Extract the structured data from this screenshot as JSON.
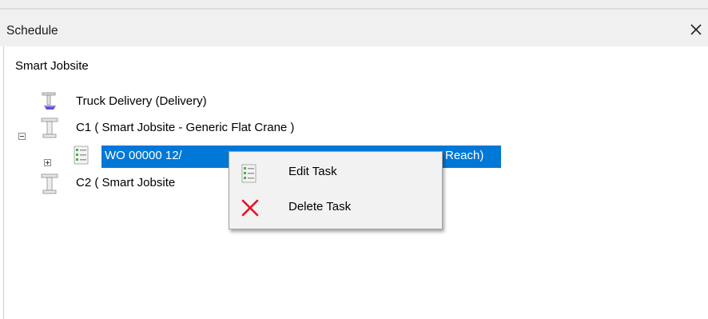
{
  "panel": {
    "title": "Schedule",
    "close_glyph": "✕"
  },
  "tree": {
    "root_label": "Smart Jobsite",
    "truck_label": "Truck Delivery (Delivery)",
    "c1_label": "C1 ( Smart Jobsite - Generic Flat Crane )",
    "wo_label_left": "WO 00000   12/",
    "wo_label_right": "Reach)",
    "c2_label": "C2 ( Smart Jobsite"
  },
  "context_menu": {
    "edit_label": "Edit Task",
    "delete_label": "Delete Task"
  },
  "colors": {
    "selection": "#0078d7",
    "delete_x": "#e81123"
  }
}
